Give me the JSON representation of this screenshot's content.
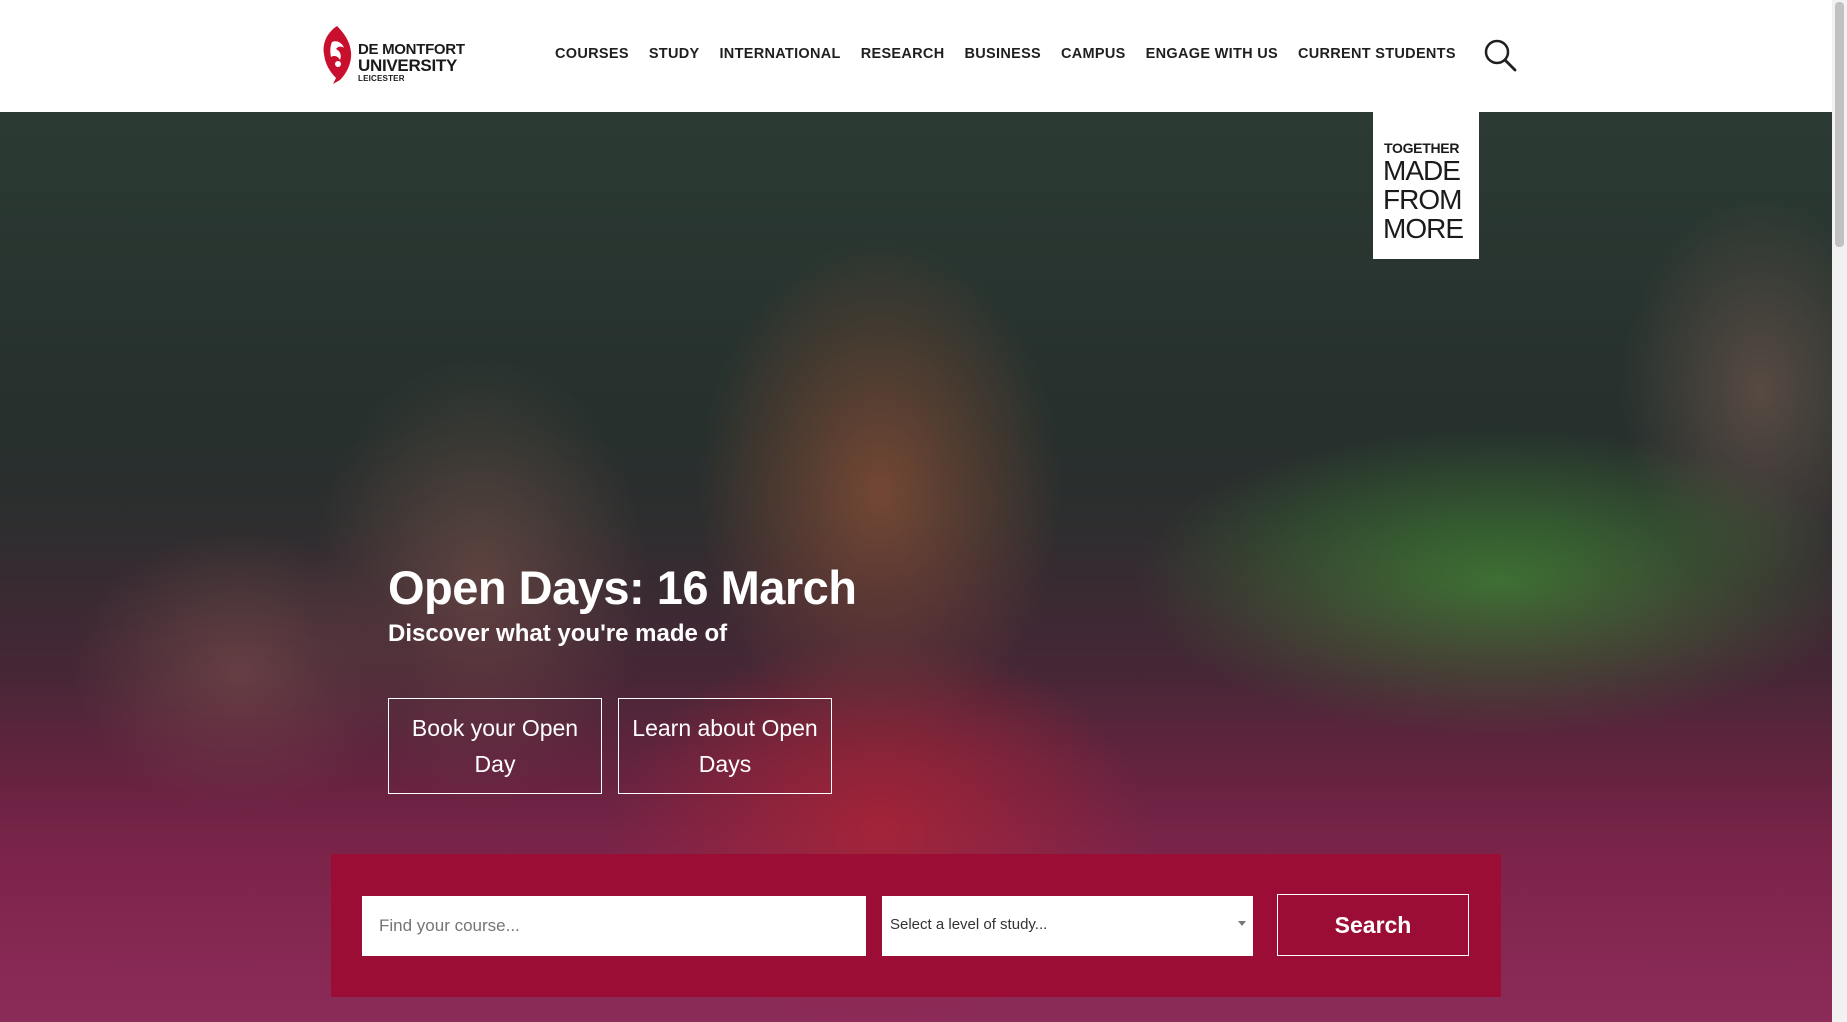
{
  "header": {
    "logo": {
      "line1": "DE MONTFORT",
      "line2": "UNIVERSITY",
      "line3": "LEICESTER",
      "icon": "dmu-lion-crest"
    },
    "nav": [
      {
        "label": "COURSES"
      },
      {
        "label": "STUDY"
      },
      {
        "label": "INTERNATIONAL"
      },
      {
        "label": "RESEARCH"
      },
      {
        "label": "BUSINESS"
      },
      {
        "label": "CAMPUS"
      },
      {
        "label": "ENGAGE WITH US"
      },
      {
        "label": "CURRENT STUDENTS"
      }
    ],
    "search_icon": "search-icon"
  },
  "hero": {
    "badge": {
      "line1": "TOGETHER",
      "line2": "MADE",
      "line3": "FROM",
      "line4": "MORE"
    },
    "title": "Open Days: 16 March",
    "subtitle": "Discover what you're made of",
    "buttons": [
      {
        "label": "Book your Open Day"
      },
      {
        "label": "Learn about Open Days"
      }
    ]
  },
  "course_search": {
    "input_placeholder": "Find your course...",
    "level_select": "Select a level of study...",
    "button_label": "Search",
    "panel_color": "#9b0d35"
  },
  "colors": {
    "brand": "#9b0d35",
    "text_dark": "#1f1f1f"
  }
}
